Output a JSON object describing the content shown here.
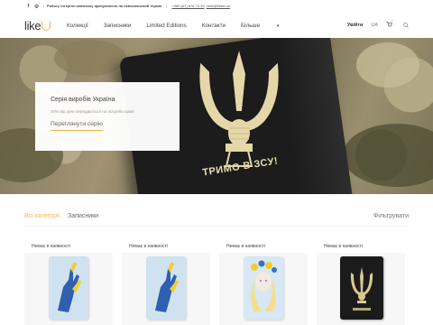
{
  "topbar": {
    "facebook_icon": "f",
    "instagram_icon": "◎",
    "notice": "Роботу інтернет-магазину призупинено на невизначений термін",
    "phone": "+380 (67) 676 74 33",
    "email": "hello@likee.ua"
  },
  "header": {
    "logo": "like",
    "nav": [
      {
        "label": "Колекції"
      },
      {
        "label": "Записники"
      },
      {
        "label": "Limited Editions"
      },
      {
        "label": "Контакти"
      },
      {
        "label": "Більше"
      }
    ],
    "more_caret": "▾",
    "login": "Увійти",
    "lang": "UA",
    "cart_count": "0"
  },
  "hero": {
    "slogan": "ТРИМО В ЗСУ!",
    "promo": {
      "title": "Серія виробів Україна",
      "subtitle": "20% від ціни передаються на потреби армії",
      "link": "Переглянути серію"
    }
  },
  "filters": {
    "all": "Всі категорії",
    "notebooks": "Записники",
    "filter_button": "Фільтрувати"
  },
  "products": [
    {
      "status": "Немає в наявності",
      "cover": "blue-hand"
    },
    {
      "status": "Немає в наявності",
      "cover": "blue-hand"
    },
    {
      "status": "Немає в наявності",
      "cover": "blue-girl"
    },
    {
      "status": "Немає в наявності",
      "cover": "black-trident"
    }
  ],
  "colors": {
    "accent": "#f0b64a",
    "text": "#333333"
  }
}
